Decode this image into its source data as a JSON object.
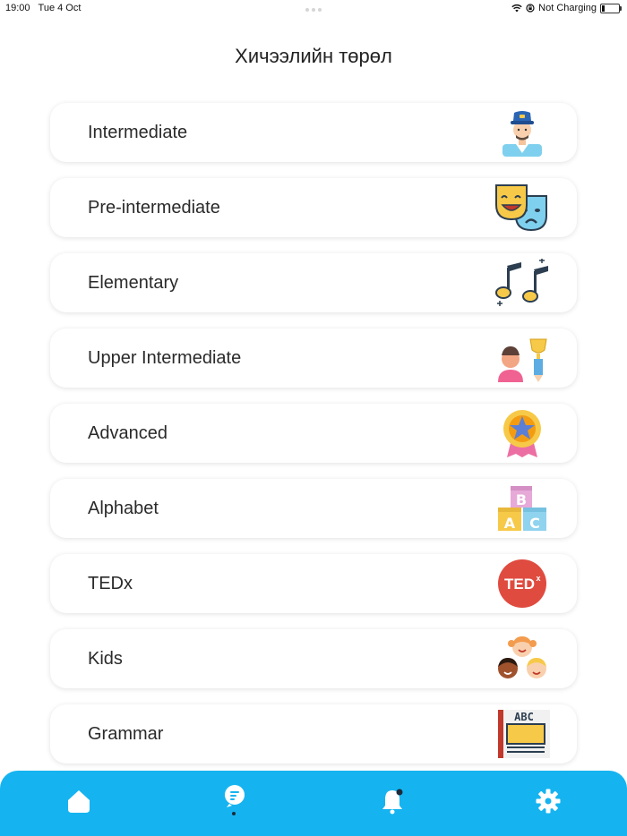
{
  "status_bar": {
    "time": "19:00",
    "date": "Tue 4 Oct",
    "charging": "Not Charging",
    "wifi_icon": "wifi-icon",
    "lock_icon": "orientation-lock-icon",
    "battery_icon": "battery-icon"
  },
  "page": {
    "title": "Хичээлийн төрөл"
  },
  "categories": [
    {
      "label": "Intermediate",
      "icon": "captain-icon"
    },
    {
      "label": "Pre-intermediate",
      "icon": "theater-masks-icon"
    },
    {
      "label": "Elementary",
      "icon": "music-notes-icon"
    },
    {
      "label": "Upper Intermediate",
      "icon": "student-trophy-icon"
    },
    {
      "label": "Advanced",
      "icon": "star-medal-icon"
    },
    {
      "label": "Alphabet",
      "icon": "abc-blocks-icon"
    },
    {
      "label": "TEDx",
      "icon": "tedx-icon",
      "text": "TED",
      "superscript": "x"
    },
    {
      "label": "Kids",
      "icon": "kids-icon"
    },
    {
      "label": "Grammar",
      "icon": "grammar-board-icon",
      "text": "ABC"
    }
  ],
  "tab_bar": {
    "color": "#15b4f0",
    "items": [
      {
        "name": "home",
        "icon": "home-icon"
      },
      {
        "name": "lessons",
        "icon": "lessons-icon",
        "active": true
      },
      {
        "name": "notifications",
        "icon": "bell-icon"
      },
      {
        "name": "settings",
        "icon": "gear-icon"
      }
    ]
  }
}
